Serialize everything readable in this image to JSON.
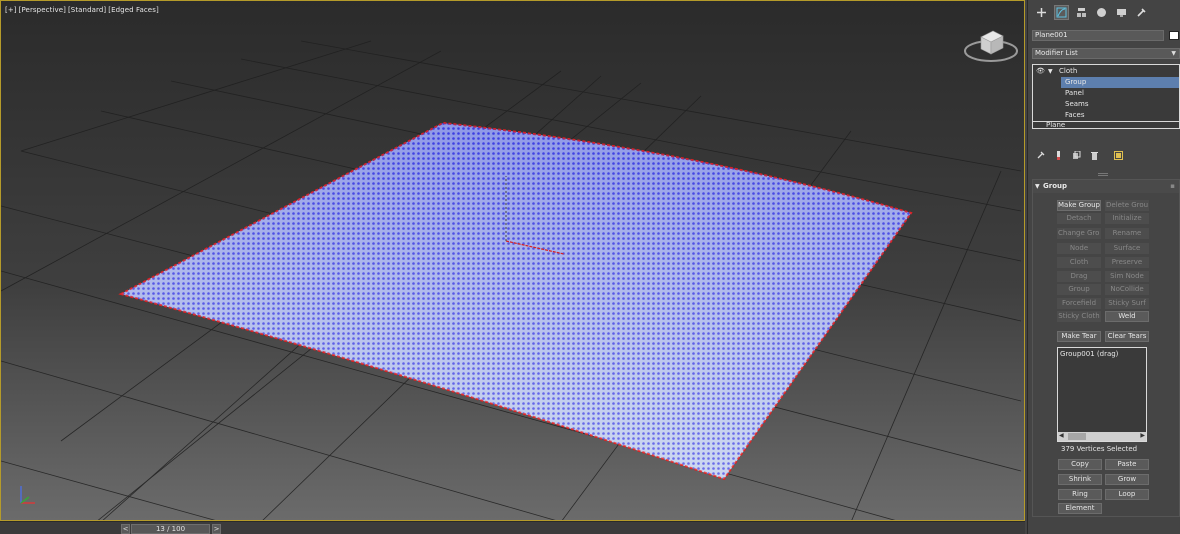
{
  "viewport": {
    "label_parts": [
      "[+]",
      "[Perspective]",
      "[Standard]",
      "[Edged Faces]"
    ]
  },
  "timeline": {
    "prev": "<",
    "next": ">",
    "frame_text": "13 / 100"
  },
  "command_panel": {
    "tabs": [
      "create-icon",
      "modify-icon",
      "hierarchy-icon",
      "motion-icon",
      "display-icon",
      "utilities-icon"
    ],
    "object_name": "Plane001",
    "object_color": "#ffffff",
    "modifier_list_label": "Modifier List",
    "stack": {
      "modifier": "Cloth",
      "subobjects": [
        "Group",
        "Panel",
        "Seams",
        "Faces"
      ],
      "selected": "Group",
      "base": "Plane"
    },
    "group_rollout": {
      "title": "Group",
      "buttons": [
        {
          "label": "Make Group",
          "enabled": true
        },
        {
          "label": "Delete Group",
          "enabled": false
        },
        {
          "label": "Detach",
          "enabled": false
        },
        {
          "label": "Initialize",
          "enabled": false
        },
        {
          "label": "Change Group",
          "enabled": false
        },
        {
          "label": "Rename",
          "enabled": false
        },
        {
          "label": "Node",
          "enabled": false
        },
        {
          "label": "Surface",
          "enabled": false
        },
        {
          "label": "Cloth",
          "enabled": false
        },
        {
          "label": "Preserve",
          "enabled": false
        },
        {
          "label": "Drag",
          "enabled": false
        },
        {
          "label": "Sim Node",
          "enabled": false
        },
        {
          "label": "Group",
          "enabled": false
        },
        {
          "label": "NoCollide",
          "enabled": false
        },
        {
          "label": "Forcefield",
          "enabled": false
        },
        {
          "label": "Sticky Surf",
          "enabled": false
        },
        {
          "label": "Sticky Cloth",
          "enabled": false
        },
        {
          "label": "Weld",
          "enabled": true
        }
      ],
      "tear_buttons": [
        "Make Tear",
        "Clear Tears"
      ],
      "group_list": [
        "Group001 (drag)"
      ],
      "vertices_selected": "379 Vertices Selected",
      "select_buttons": [
        "Copy",
        "Paste",
        "Shrink",
        "Grow",
        "Ring",
        "Loop",
        "Element"
      ]
    }
  },
  "colors": {
    "mesh_fill": "#c8d6f2",
    "mesh_vertex": "#3a3ae0",
    "mesh_border": "#e02020",
    "selection_highlight": "#5d7fae",
    "viewport_border": "#b59b2a"
  }
}
